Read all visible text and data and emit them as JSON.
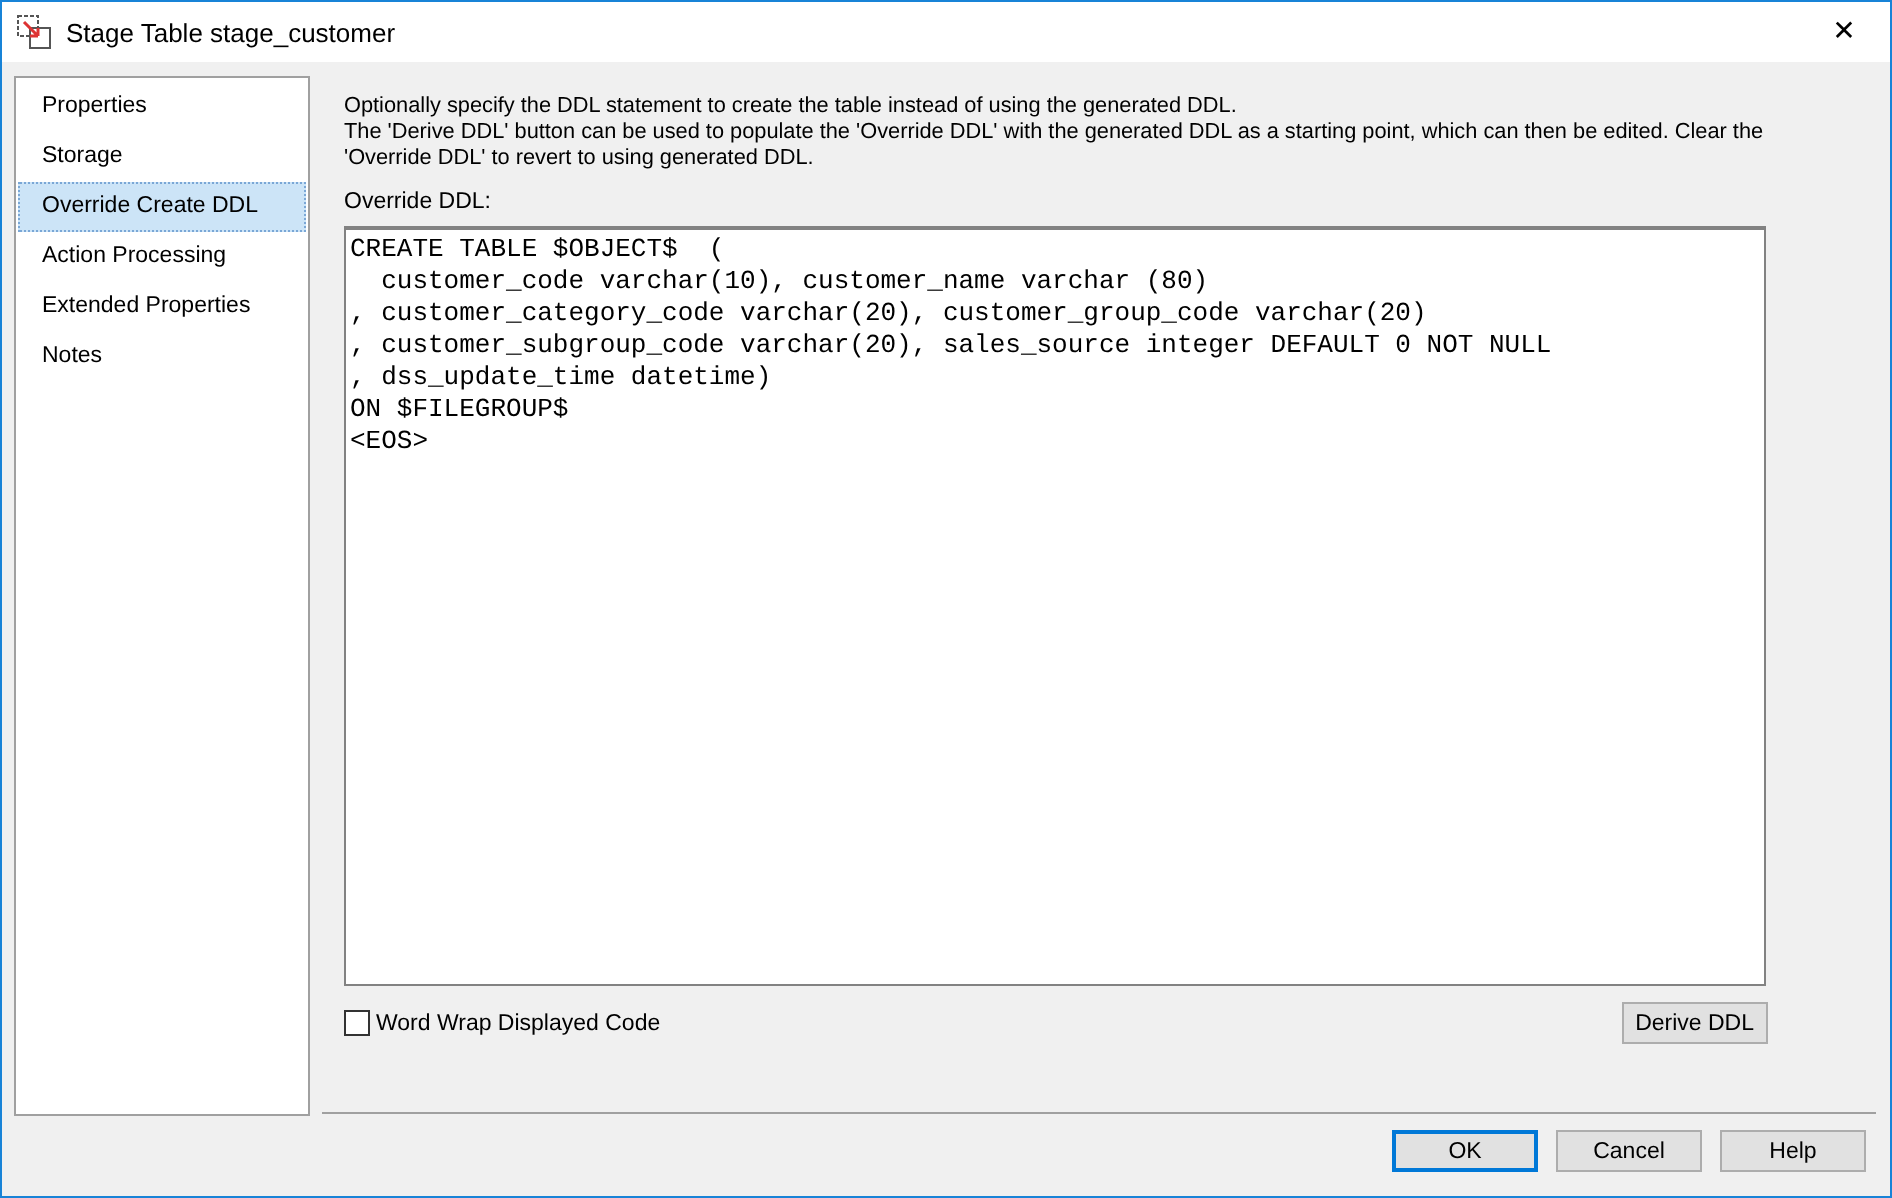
{
  "window": {
    "title": "Stage Table stage_customer",
    "close": "✕"
  },
  "sidebar": {
    "items": [
      {
        "label": "Properties",
        "selected": false
      },
      {
        "label": "Storage",
        "selected": false
      },
      {
        "label": "Override Create DDL",
        "selected": true
      },
      {
        "label": "Action Processing",
        "selected": false
      },
      {
        "label": "Extended Properties",
        "selected": false
      },
      {
        "label": "Notes",
        "selected": false
      }
    ]
  },
  "description": [
    "Optionally specify the DDL statement to create the table instead of using the generated DDL.",
    "The 'Derive DDL' button can be used to populate the 'Override DDL' with the generated DDL as a starting point, which can then be edited. Clear the 'Override DDL' to revert to using generated DDL."
  ],
  "editor": {
    "label": "Override DDL:",
    "lines": [
      "CREATE TABLE $OBJECT$  (",
      "  customer_code varchar(10), customer_name varchar (80)",
      ", customer_category_code varchar(20), customer_group_code varchar(20)",
      ", customer_subgroup_code varchar(20), sales_source integer DEFAULT 0 NOT NULL",
      ", dss_update_time datetime)",
      "ON $FILEGROUP$",
      "<EOS>"
    ]
  },
  "word_wrap": {
    "label": "Word Wrap Displayed Code",
    "checked": false
  },
  "derive_button": "Derive DDL",
  "buttons": [
    {
      "label": "OK",
      "default": true
    },
    {
      "label": "Cancel",
      "default": false
    },
    {
      "label": "Help",
      "default": false
    }
  ]
}
